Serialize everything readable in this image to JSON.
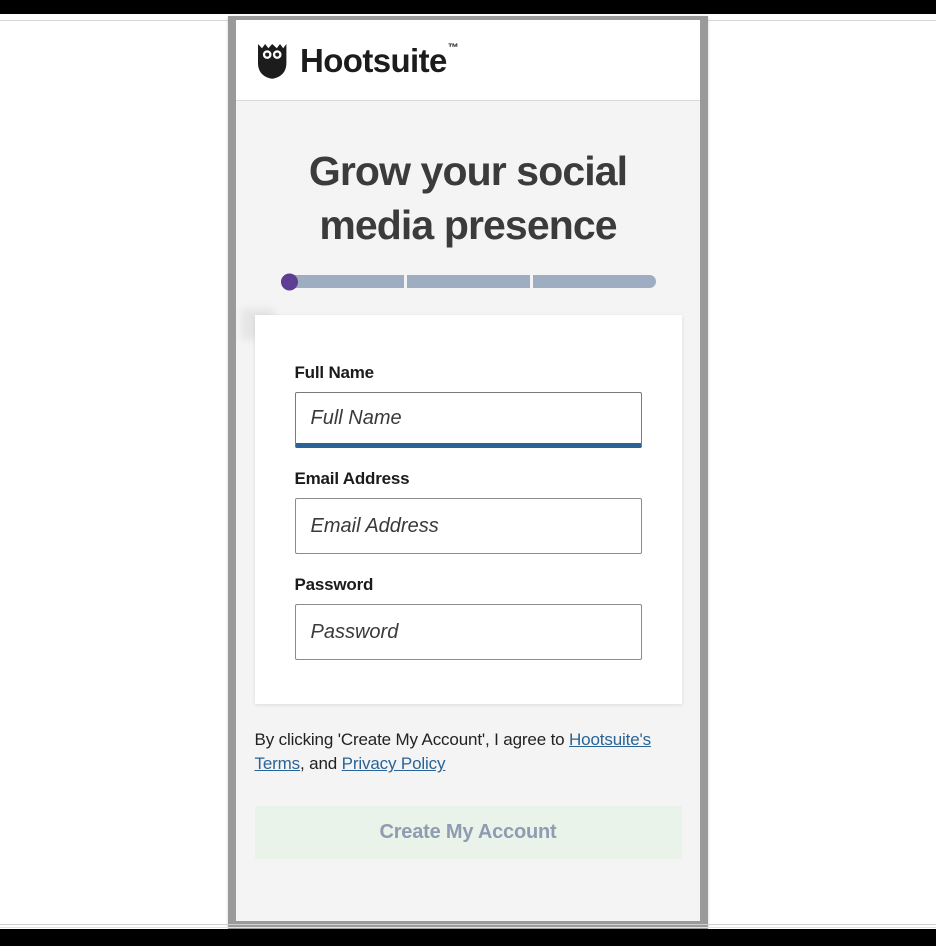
{
  "brand": {
    "name": "Hootsuite",
    "trademark": "™",
    "logo_icon": "owl-icon"
  },
  "headline": "Grow your social media presence",
  "progress": {
    "total_steps": 3,
    "current_step": 1,
    "dot_color": "#5d3e92",
    "track_color": "#9fadc2"
  },
  "form": {
    "fields": [
      {
        "label": "Full Name",
        "placeholder": "Full Name",
        "value": "",
        "name": "full-name",
        "focused": true
      },
      {
        "label": "Email Address",
        "placeholder": "Email Address",
        "value": "",
        "name": "email-address",
        "focused": false
      },
      {
        "label": "Password",
        "placeholder": "Password",
        "value": "",
        "name": "password",
        "focused": false
      }
    ]
  },
  "terms": {
    "prefix": "By clicking 'Create My Account', I agree to ",
    "terms_link": "Hootsuite's Terms",
    "middle": ", and ",
    "privacy_link": "Privacy Policy"
  },
  "submit": {
    "label": "Create My Account",
    "background": "#e9f3ea",
    "text_color": "#8f9bb0",
    "disabled": true
  }
}
